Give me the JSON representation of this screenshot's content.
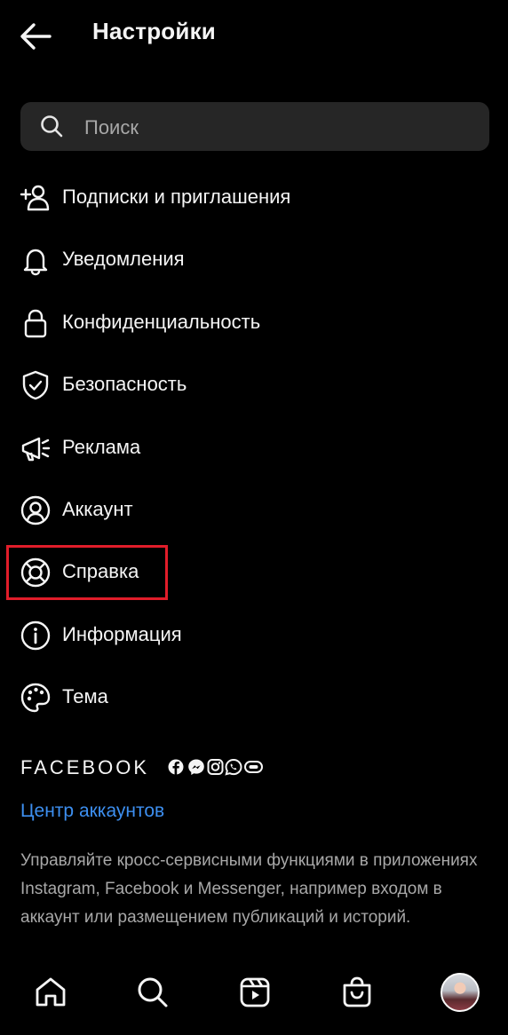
{
  "header": {
    "title": "Настройки"
  },
  "search": {
    "placeholder": "Поиск",
    "value": ""
  },
  "menu": {
    "items": [
      {
        "label": "Подписки и приглашения",
        "icon": "add-user-icon"
      },
      {
        "label": "Уведомления",
        "icon": "bell-icon"
      },
      {
        "label": "Конфиденциальность",
        "icon": "lock-icon"
      },
      {
        "label": "Безопасность",
        "icon": "shield-icon"
      },
      {
        "label": "Реклама",
        "icon": "megaphone-icon"
      },
      {
        "label": "Аккаунт",
        "icon": "account-circle-icon"
      },
      {
        "label": "Справка",
        "icon": "lifebuoy-icon",
        "highlighted": true
      },
      {
        "label": "Информация",
        "icon": "info-icon"
      },
      {
        "label": "Тема",
        "icon": "palette-icon"
      }
    ]
  },
  "meta_section": {
    "brand": "FACEBOOK",
    "app_icons": [
      "facebook-icon",
      "messenger-icon",
      "instagram-icon",
      "whatsapp-icon",
      "portal-icon"
    ],
    "accounts_center_label": "Центр аккаунтов",
    "description": "Управляйте кросс-сервисными функциями в приложениях Instagram, Facebook и Messenger, например входом в аккаунт или размещением публикаций и историй."
  },
  "bottom_nav": {
    "items": [
      "home-icon",
      "search-icon",
      "reels-icon",
      "shop-icon",
      "profile-avatar"
    ]
  },
  "colors": {
    "background": "#000000",
    "text": "#f5f5f5",
    "search_bg": "#262626",
    "link": "#3d8ff0",
    "secondary_text": "#a8a8a8",
    "highlight_border": "#e11d2a"
  }
}
